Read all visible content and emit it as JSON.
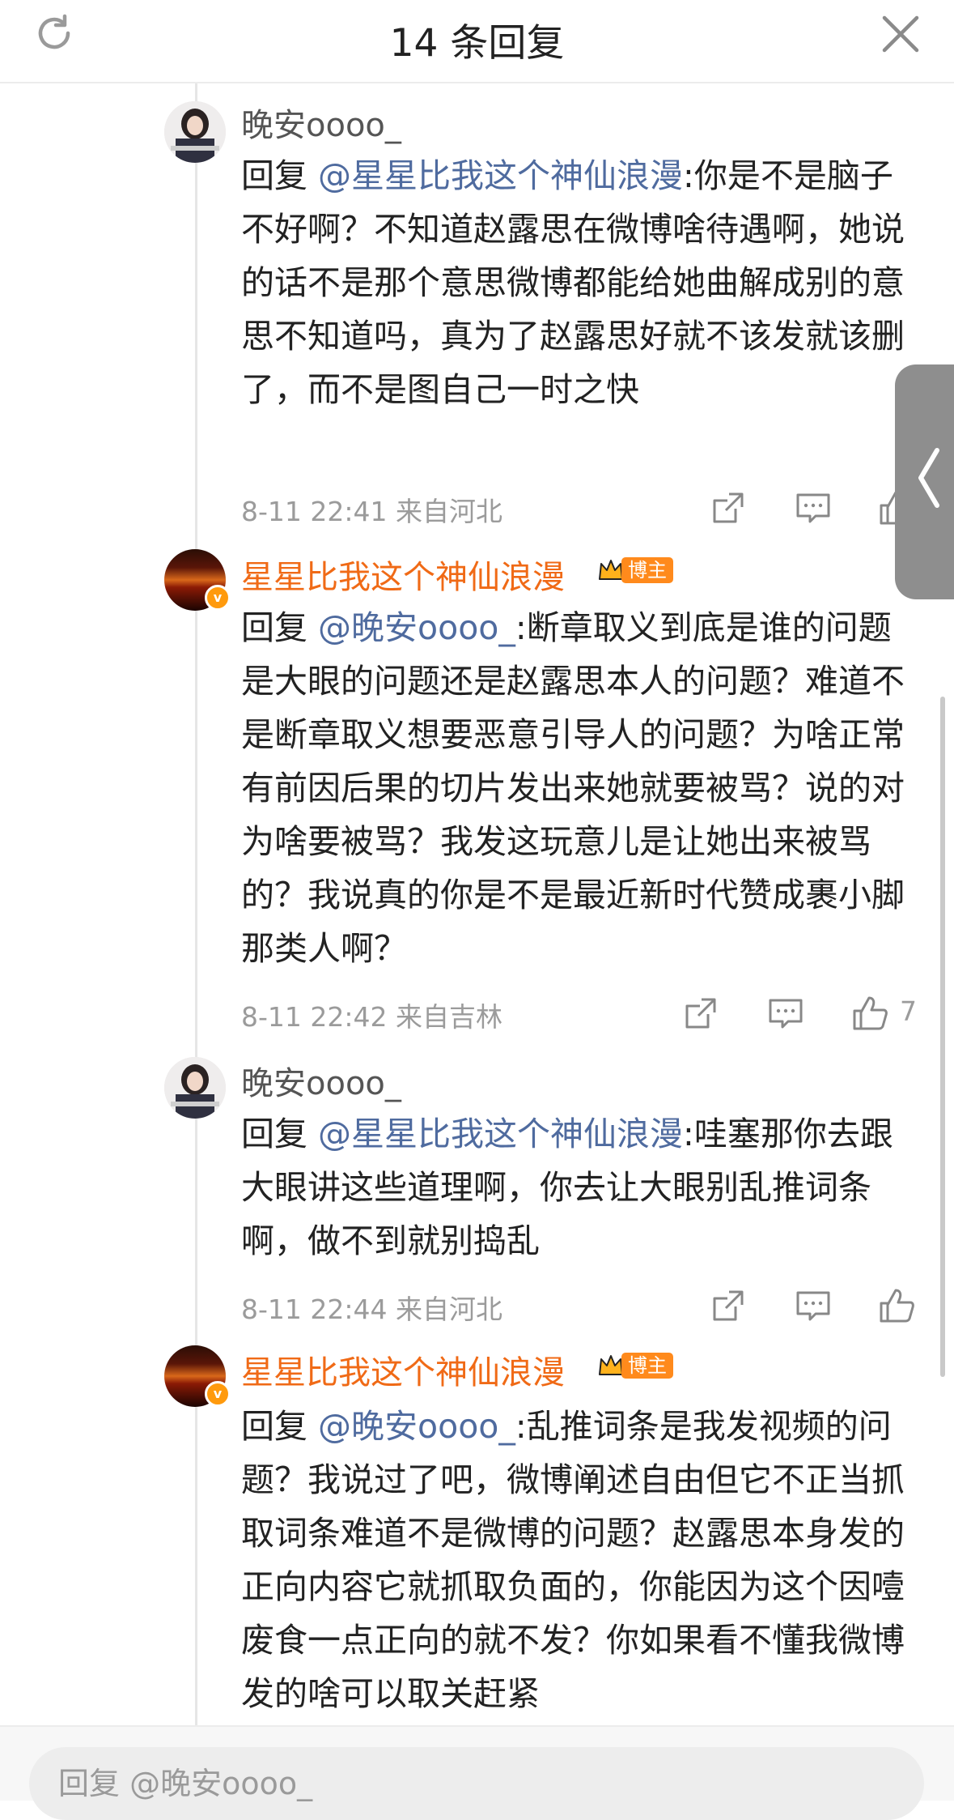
{
  "header": {
    "title": "14 条回复",
    "refresh_icon": "refresh-icon",
    "close_icon": "close-icon"
  },
  "replies": [
    {
      "user": "晚安oooo_",
      "reply_prefix": "回复",
      "mention": "@星星比我这个神仙浪漫",
      "text": ":你是不是脑子不好啊？不知道赵露思在微博啥待遇啊，她说的话不是那个意思微博都能给她曲解成别的意思不知道吗，真为了赵露思好就不该发就该删了，而不是图自己一时之快",
      "time": "8-11 22:41",
      "location": "来自河北",
      "likes": ""
    },
    {
      "user": "星星比我这个神仙浪漫",
      "badge": "博主",
      "reply_prefix": "回复",
      "mention": "@晚安oooo_",
      "text": ":断章取义到底是谁的问题 是大眼的问题还是赵露思本人的问题？难道不是断章取义想要恶意引导人的问题？为啥正常有前因后果的切片发出来她就要被骂？说的对为啥要被骂？我发这玩意儿是让她出来被骂的？我说真的你是不是最近新时代赞成裹小脚那类人啊？",
      "time": "8-11 22:42",
      "location": "来自吉林",
      "likes": "7"
    },
    {
      "user": "晚安oooo_",
      "reply_prefix": "回复",
      "mention": "@星星比我这个神仙浪漫",
      "text": ":哇塞那你去跟大眼讲这些道理啊，你去让大眼别乱推词条啊，做不到就别捣乱",
      "time": "8-11 22:44",
      "location": "来自河北",
      "likes": ""
    },
    {
      "user": "星星比我这个神仙浪漫",
      "badge": "博主",
      "reply_prefix": "回复",
      "mention": "@晚安oooo_",
      "text": ":乱推词条是我发视频的问题？我说过了吧，微博阐述自由但它不正当抓取词条难道不是微博的问题？赵露思本身发的正向内容它就抓取负面的，你能因为这个因噎废食一点正向的就不发？你如果看不懂我微博发的啥可以取关赶紧"
    }
  ],
  "composer": {
    "placeholder": "回复 @晚安oooo_"
  },
  "colors": {
    "mention": "#4f6b9f",
    "blogger_name": "#f06a16",
    "badge": "#ff8a1c",
    "meta": "#9b9b9b"
  }
}
